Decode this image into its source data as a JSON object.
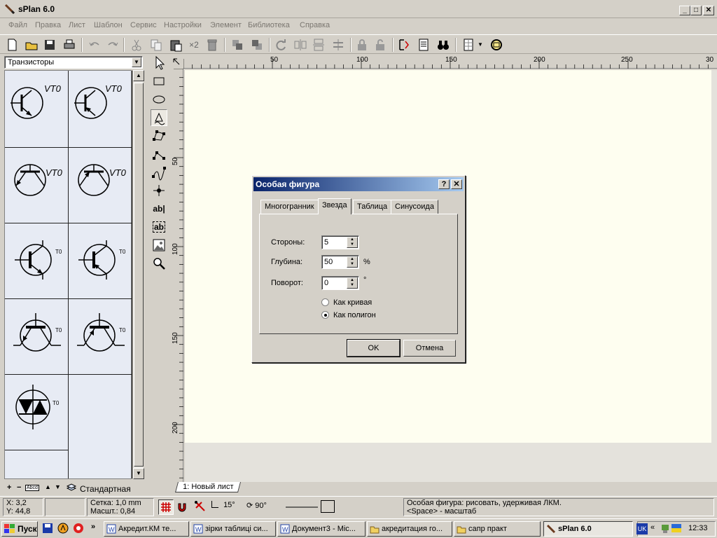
{
  "app": {
    "title": "sPlan 6.0"
  },
  "window_controls": {
    "minimize": "_",
    "maximize": "□",
    "close": "✕"
  },
  "menu": [
    "Файл",
    "Правка",
    "Лист",
    "Шаблон",
    "Сервис",
    "Настройки",
    "Элемент",
    "Библиотека",
    "Справка"
  ],
  "toolbar": {
    "multiplier_label": "×2"
  },
  "library": {
    "category": "Транзисторы",
    "footer_label": "Стандартная",
    "footer_abcd": "Abcd",
    "components": [
      {
        "label": "VT0",
        "icon": "npn-transistor-icon"
      },
      {
        "label": "VT0",
        "icon": "pnp-transistor-icon"
      },
      {
        "label": "VT0",
        "icon": "npn-transistor-horizontal-icon"
      },
      {
        "label": "VT0",
        "icon": "pnp-transistor-horizontal-icon"
      },
      {
        "label": "T0",
        "icon": "npn-transistor-bar-icon"
      },
      {
        "label": "T0",
        "icon": "pnp-transistor-bar-icon"
      },
      {
        "label": "T0",
        "icon": "jfet-down-icon"
      },
      {
        "label": "T0",
        "icon": "jfet-up-icon"
      },
      {
        "label": "T0",
        "icon": "triac-icon"
      }
    ]
  },
  "rulers": {
    "top": [
      "50",
      "100",
      "150",
      "200",
      "250",
      "30"
    ],
    "left": [
      "50",
      "100",
      "150",
      "200"
    ]
  },
  "sheet_tab": "1: Новый лист",
  "status": {
    "x": "X: 3,2",
    "y": "Y: 44,8",
    "grid": "Сетка:  1,0 mm",
    "scale": "Масшт.: 0,84",
    "angle1": "15°",
    "angle2": "90°",
    "hint1": "Особая фигура: рисовать, удерживая ЛКМ.",
    "hint2": "<Space> - масштаб"
  },
  "dialog": {
    "title": "Особая фигура",
    "help": "?",
    "close": "✕",
    "tabs": [
      "Многогранник",
      "Звезда",
      "Таблица",
      "Синусоида"
    ],
    "selected_tab": "Звезда",
    "fields": [
      {
        "label": "Стороны:",
        "value": "5",
        "unit": ""
      },
      {
        "label": "Глубина:",
        "value": "50",
        "unit": "%"
      },
      {
        "label": "Поворот:",
        "value": "0",
        "unit": "°"
      }
    ],
    "radios": [
      {
        "label": "Как кривая",
        "checked": false
      },
      {
        "label": "Как полигон",
        "checked": true
      }
    ],
    "ok": "OK",
    "cancel": "Отмена"
  },
  "taskbar": {
    "start": "Пуск",
    "chevron": "»",
    "buttons": [
      "Акредит.КМ те...",
      "зірки таблиці си...",
      "Документ3 - Mic...",
      "акредитация го...",
      "сапр практ",
      "sPlan 6.0"
    ],
    "active": "sPlan 6.0",
    "lang": "UK",
    "tray_chevron": "«",
    "clock": "12:33"
  }
}
